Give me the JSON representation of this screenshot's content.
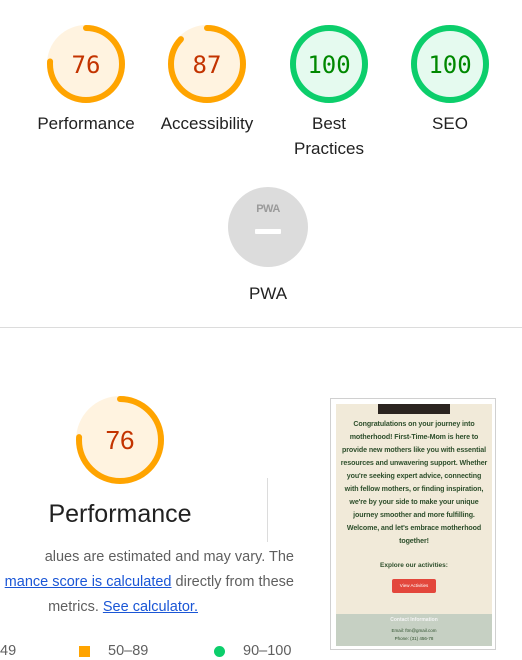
{
  "colors": {
    "average": "#ffa400",
    "average_bg": "#fff3e0",
    "average_text": "#c33300",
    "pass": "#0cce6b",
    "pass_bg": "#e5faef",
    "pass_text": "#008800",
    "na": "#cccccc",
    "link": "#1a56d6"
  },
  "gauges": [
    {
      "score": "76",
      "fraction": 0.76,
      "status": "average",
      "label": "Performance"
    },
    {
      "score": "87",
      "fraction": 0.87,
      "status": "average",
      "label": "Accessibility"
    },
    {
      "score": "100",
      "fraction": 1.0,
      "status": "pass",
      "label_line1": "Best",
      "label_line2": "Practices"
    },
    {
      "score": "100",
      "fraction": 1.0,
      "status": "pass",
      "label": "SEO"
    }
  ],
  "pwa": {
    "badge": "PWA",
    "label": "PWA",
    "icon": "pwa-badge-icon"
  },
  "performance": {
    "score": "76",
    "fraction": 0.76,
    "title": "Performance",
    "desc_line1": "alues are estimated and may vary. The",
    "desc_link1": "mance score is calculated",
    "desc_line2_rest": " directly from these",
    "desc_line3_start": "metrics. ",
    "desc_link2": "See calculator."
  },
  "legend": {
    "fail": "49",
    "average": "50–89",
    "pass": "90–100"
  },
  "screenshot": {
    "text_lines": [
      "Congratulations on your journey into",
      "motherhood! First-Time-Mom is here to",
      "provide new mothers like you with essential",
      "resources and unwavering support. Whether",
      "you're seeking expert advice, connecting",
      "with fellow mothers, or finding inspiration,",
      "we're by your side to make your unique",
      "journey smoother and more fulfilling.",
      "Welcome, and let's embrace motherhood",
      "together!"
    ],
    "explore": "Explore our activities:",
    "button": "View Activities",
    "footer_title": "Contact Information",
    "footer_email": "Email: ftm@gmail.com",
    "footer_phone": "Phone: (31) 456-78"
  }
}
